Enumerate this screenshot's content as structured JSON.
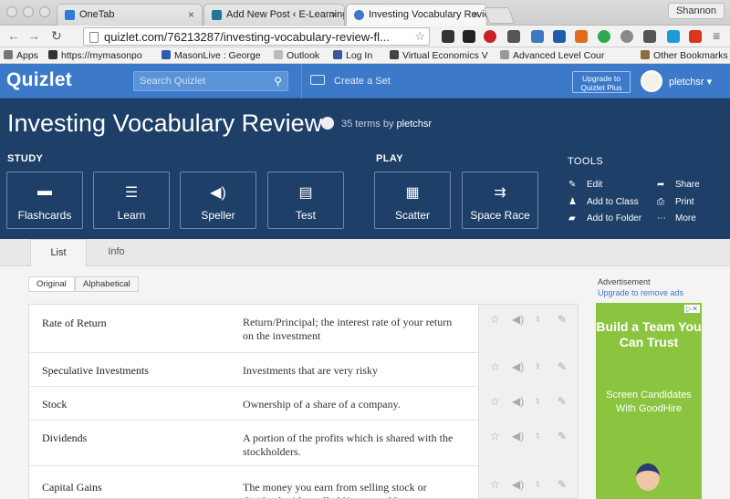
{
  "browser": {
    "tabs": [
      {
        "title": "OneTab",
        "active": false
      },
      {
        "title": "Add New Post ‹ E-Learning",
        "active": false
      },
      {
        "title": "Investing Vocabulary Revie",
        "active": true
      }
    ],
    "user": "Shannon",
    "url": "quizlet.com/76213287/investing-vocabulary-review-fl...",
    "bookmarks": [
      "Apps",
      "https://mymasonpo",
      "MasonLive : George",
      "Outlook",
      "Log In",
      "Virtual Economics V",
      "Advanced Level Cour",
      "Other Bookmarks"
    ]
  },
  "quizlet": {
    "logo": "Quizlet",
    "search_placeholder": "Search Quizlet",
    "create_label": "Create a Set",
    "upgrade_line1": "Upgrade to",
    "upgrade_line2": "Quizlet Plus",
    "username": "pletchsr"
  },
  "set": {
    "title": "Investing Vocabulary Review",
    "terms_label": "35 terms by",
    "author": "pletchsr"
  },
  "study": {
    "label": "STUDY",
    "modes": [
      "Flashcards",
      "Learn",
      "Speller",
      "Test"
    ]
  },
  "play": {
    "label": "PLAY",
    "modes": [
      "Scatter",
      "Space Race"
    ]
  },
  "tools": {
    "label": "TOOLS",
    "items": [
      "Edit",
      "Add to Class",
      "Add to Folder",
      "Share",
      "Print",
      "More"
    ]
  },
  "tabs": [
    "List",
    "Info"
  ],
  "sort": [
    "Original",
    "Alphabetical"
  ],
  "terms": [
    {
      "term": "Rate of Return",
      "definition": "Return/Principal; the interest rate of your return on the investment"
    },
    {
      "term": "Speculative Investments",
      "definition": "Investments that are very risky"
    },
    {
      "term": "Stock",
      "definition": "Ownership of a share of a company."
    },
    {
      "term": "Dividends",
      "definition": "A portion of the profits which is shared with the stockholders."
    },
    {
      "term": "Capital Gains",
      "definition": "The money you earn from selling stock or dividends. Also called Karma and Income"
    }
  ],
  "ad": {
    "label": "Advertisement",
    "link": "Upgrade to remove ads",
    "headline": "Build a Team You Can Trust",
    "body": "Screen Candidates With GoodHire"
  }
}
